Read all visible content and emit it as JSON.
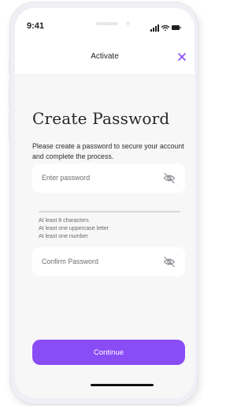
{
  "status_bar": {
    "time": "9:41"
  },
  "header": {
    "title": "Activate"
  },
  "page": {
    "title": "Create Password",
    "description": "Please create a password to secure your account and complete the process."
  },
  "password_field": {
    "placeholder": "Enter password",
    "value": ""
  },
  "strength": {
    "progress": 0
  },
  "rules": [
    "At least 8 characters",
    "At least one uppercase letter",
    "At least one number"
  ],
  "confirm_field": {
    "placeholder": "Confirm Password",
    "value": ""
  },
  "actions": {
    "continue_label": "Continue"
  },
  "icons": {
    "close": "close-icon",
    "eye": "eye-off-icon",
    "signal": "signal-icon",
    "wifi": "wifi-icon",
    "battery": "battery-icon"
  },
  "colors": {
    "accent": "#8a4cf5",
    "background": "#f7f7f8"
  }
}
